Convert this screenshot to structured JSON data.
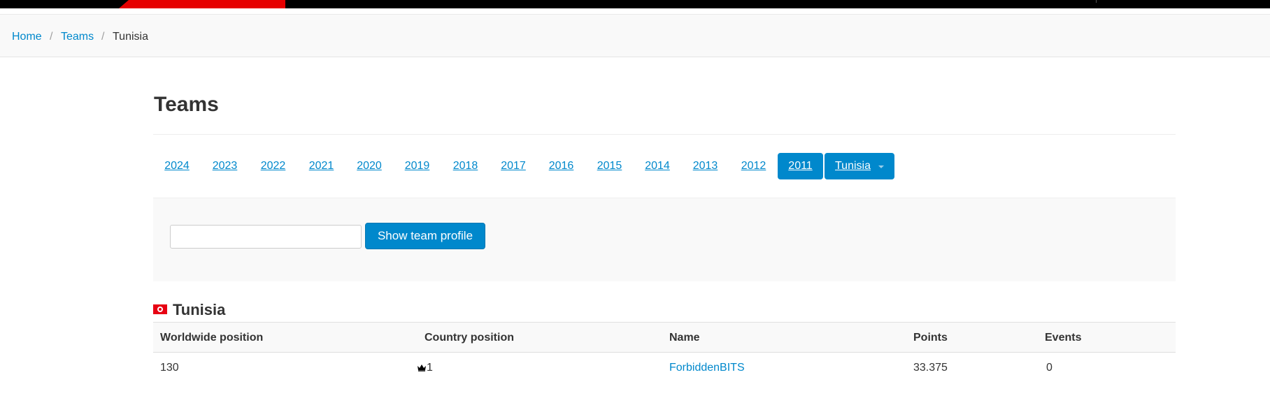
{
  "breadcrumb": {
    "home": "Home",
    "separator": "/",
    "teams": "Teams",
    "current": "Tunisia"
  },
  "page": {
    "title": "Teams"
  },
  "year_tabs": [
    "2024",
    "2023",
    "2022",
    "2021",
    "2020",
    "2019",
    "2018",
    "2017",
    "2016",
    "2015",
    "2014",
    "2013",
    "2012",
    "2011"
  ],
  "active_year": "2011",
  "country_dropdown": {
    "label": "Tunisia"
  },
  "search": {
    "input_value": "",
    "button_label": "Show team profile"
  },
  "country_section": {
    "name": "Tunisia",
    "flag_icon": "tunisia-flag-icon"
  },
  "table": {
    "headers": {
      "worldwide": "Worldwide position",
      "country": "Country position",
      "name": "Name",
      "points": "Points",
      "events": "Events"
    },
    "rows": [
      {
        "worldwide": "130",
        "country": "1",
        "country_icon": "crown-icon",
        "name": "ForbiddenBITS",
        "points": "33.375",
        "events": "0"
      }
    ]
  },
  "colors": {
    "link": "#0088cc",
    "active_tab": "#0088cc",
    "topbar": "#000000",
    "topbar_accent": "#e60000",
    "flag": "#e70013"
  }
}
